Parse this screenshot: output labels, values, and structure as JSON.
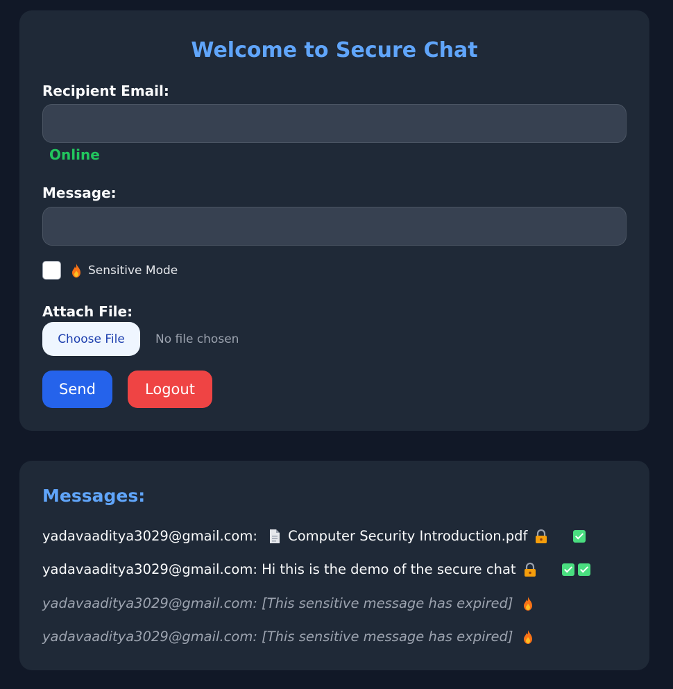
{
  "compose": {
    "title": "Welcome to Secure Chat",
    "recipient_label": "Recipient Email:",
    "recipient_value": "",
    "recipient_status": "Online",
    "status_color": "#22c55e",
    "message_label": "Message:",
    "message_value": "",
    "sensitive_mode_label": "Sensitive Mode",
    "sensitive_mode_checked": false,
    "attach_label": "Attach File:",
    "choose_file_label": "Choose File",
    "file_status": "No file chosen",
    "send_label": "Send",
    "logout_label": "Logout"
  },
  "messages": {
    "title": "Messages:",
    "items": [
      {
        "sender": "yadavaaditya3029@gmail.com",
        "separator": ": ",
        "type": "file",
        "icon": "document-icon",
        "text": "Computer Security Introduction.pdf",
        "encrypted": true,
        "read_checks": 1
      },
      {
        "sender": "yadavaaditya3029@gmail.com",
        "separator": ": ",
        "type": "text",
        "text": "Hi this is the demo of the secure chat",
        "encrypted": true,
        "read_checks": 2
      },
      {
        "sender": "yadavaaditya3029@gmail.com",
        "separator": ": ",
        "type": "expired",
        "text": "[This sensitive message has expired]",
        "icon": "flame-icon"
      },
      {
        "sender": "yadavaaditya3029@gmail.com",
        "separator": ": ",
        "type": "expired",
        "text": "[This sensitive message has expired]",
        "icon": "flame-icon"
      }
    ]
  }
}
